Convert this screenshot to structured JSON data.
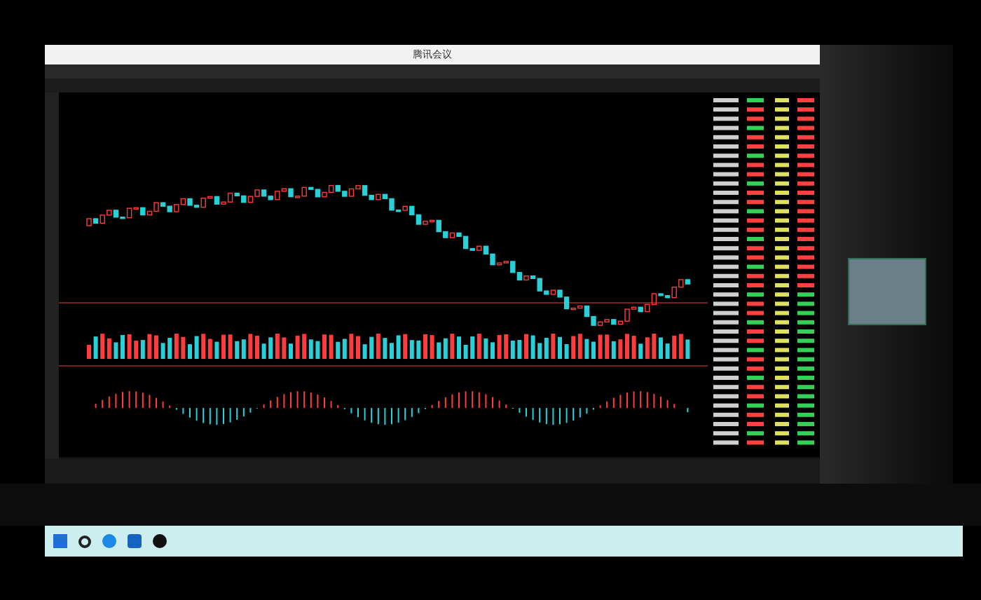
{
  "window": {
    "title": "腾讯会议"
  }
}
